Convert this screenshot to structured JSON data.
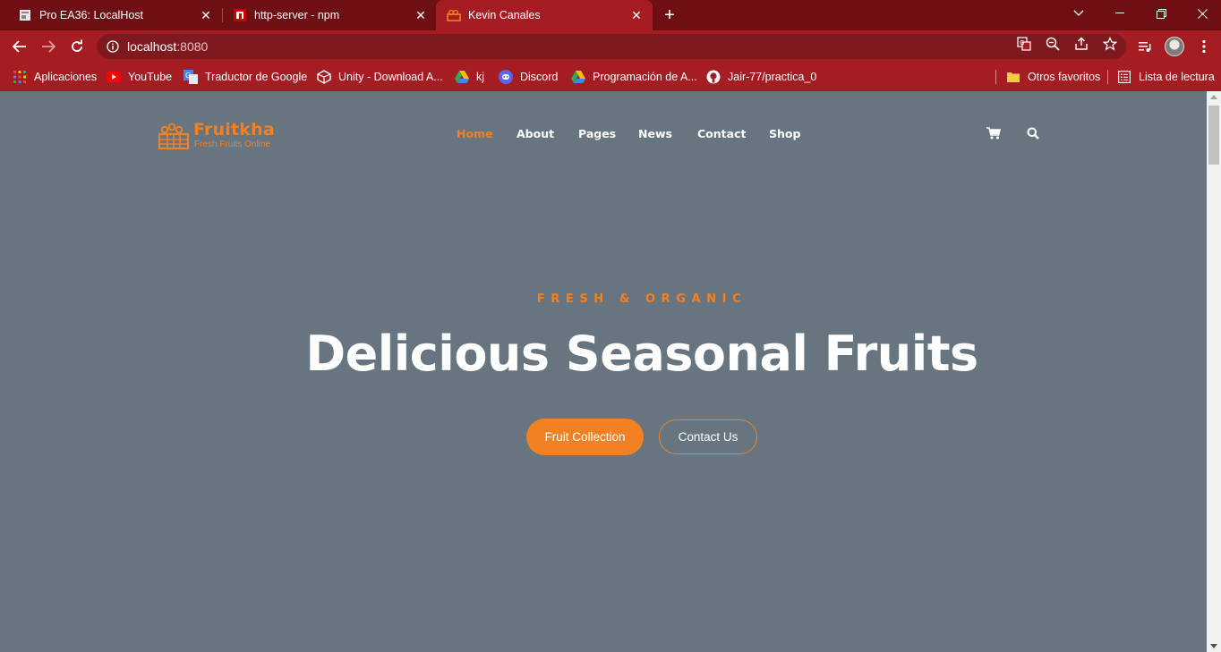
{
  "browser": {
    "tabs": [
      {
        "title": "Pro EA36: LocalHost",
        "active": false
      },
      {
        "title": "http-server - npm",
        "active": false
      },
      {
        "title": "Kevin Canales",
        "active": true
      }
    ],
    "url_host": "localhost",
    "url_port": ":8080",
    "bookmarks": [
      {
        "label": "Aplicaciones",
        "icon": "apps-grid-icon"
      },
      {
        "label": "YouTube",
        "icon": "youtube-icon"
      },
      {
        "label": "Traductor de Google",
        "icon": "google-translate-icon"
      },
      {
        "label": "Unity - Download A...",
        "icon": "unity-icon"
      },
      {
        "label": "kj",
        "icon": "google-drive-icon"
      },
      {
        "label": "Discord",
        "icon": "discord-icon"
      },
      {
        "label": "Programación de A...",
        "icon": "google-drive-icon"
      },
      {
        "label": "Jair-77/practica_0",
        "icon": "github-icon"
      }
    ],
    "other_bookmarks": "Otros favoritos",
    "reading_list": "Lista de lectura"
  },
  "site": {
    "brand": "Fruitkha",
    "tagline": "Fresh Fruits Online",
    "accent": "#f28123",
    "nav": [
      {
        "label": "Home",
        "active": true
      },
      {
        "label": "About",
        "active": false
      },
      {
        "label": "Pages",
        "active": false
      },
      {
        "label": "News",
        "active": false
      },
      {
        "label": "Contact",
        "active": false
      },
      {
        "label": "Shop",
        "active": false
      }
    ]
  },
  "hero": {
    "subtitle": "FRESH & ORGANIC",
    "title": "Delicious Seasonal Fruits",
    "primary_button": "Fruit Collection",
    "secondary_button": "Contact Us"
  }
}
